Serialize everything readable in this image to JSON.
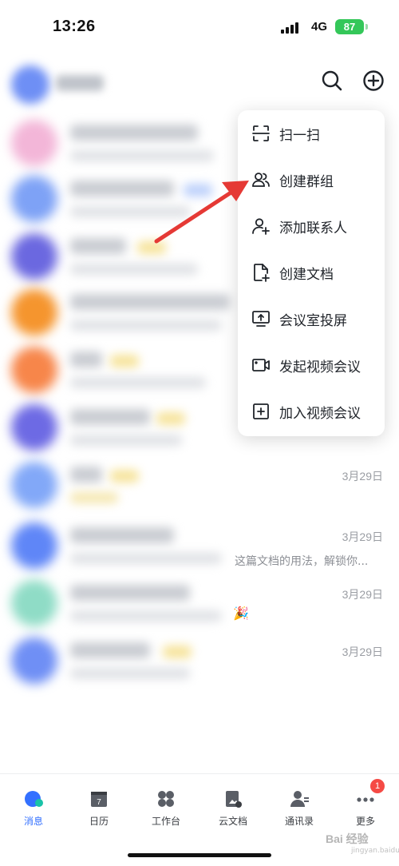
{
  "status_bar": {
    "time": "13:26",
    "network": "4G",
    "battery": "87"
  },
  "header": {
    "search_icon": "search-icon",
    "add_icon": "plus-circle-icon"
  },
  "menu": {
    "items": [
      {
        "label": "扫一扫",
        "icon": "scan-icon"
      },
      {
        "label": "创建群组",
        "icon": "group-icon"
      },
      {
        "label": "添加联系人",
        "icon": "add-contact-icon"
      },
      {
        "label": "创建文档",
        "icon": "new-doc-icon"
      },
      {
        "label": "会议室投屏",
        "icon": "screen-cast-icon"
      },
      {
        "label": "发起视频会议",
        "icon": "video-icon"
      },
      {
        "label": "加入视频会议",
        "icon": "join-meeting-icon"
      }
    ]
  },
  "chats": [
    {
      "time": "3月29日",
      "preview": ""
    },
    {
      "time": "3月29日",
      "preview": "这篇文档的用法，解锁你..."
    },
    {
      "time": "3月29日",
      "preview": ""
    },
    {
      "time": "3月29日",
      "preview": ""
    }
  ],
  "tab_bar": {
    "tabs": [
      {
        "label": "消息",
        "icon": "message-icon",
        "active": true
      },
      {
        "label": "日历",
        "icon": "calendar-icon",
        "calendar_day": "7"
      },
      {
        "label": "工作台",
        "icon": "workspace-icon"
      },
      {
        "label": "云文档",
        "icon": "cloud-doc-icon"
      },
      {
        "label": "通讯录",
        "icon": "contacts-icon"
      },
      {
        "label": "更多",
        "icon": "more-icon",
        "badge": "1"
      }
    ]
  },
  "colors": {
    "accent": "#3370ff",
    "annotation_arrow": "#e53935",
    "badge": "#f54a45"
  },
  "watermark": {
    "text": "Bai 经验",
    "sub": "jingyan.baidu.com"
  }
}
